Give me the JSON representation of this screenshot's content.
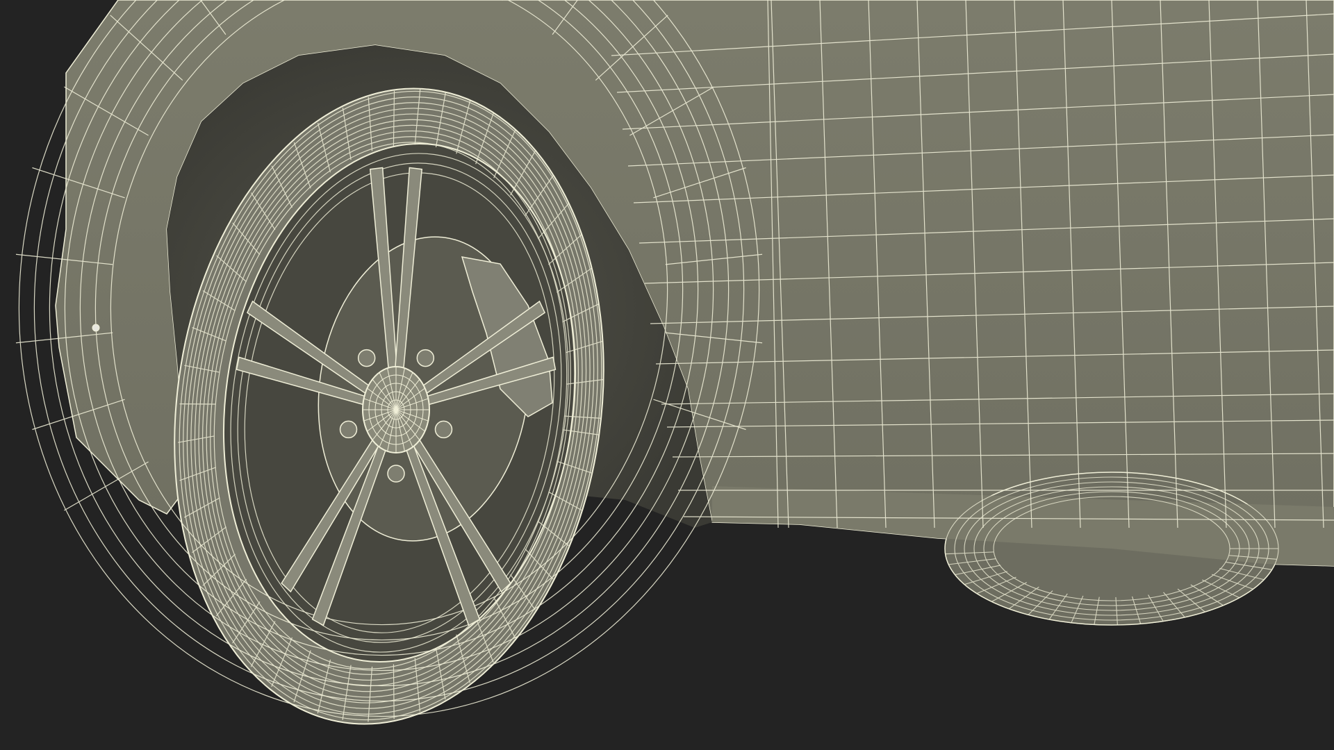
{
  "scene": {
    "subject": "car-front-wheel-wireframe",
    "colors": {
      "background": "#232323",
      "surface": "#7a7a6a",
      "surface_shadow": "#5e5e52",
      "surface_dark": "#4a4a42",
      "wire": "#f0efd8"
    }
  }
}
